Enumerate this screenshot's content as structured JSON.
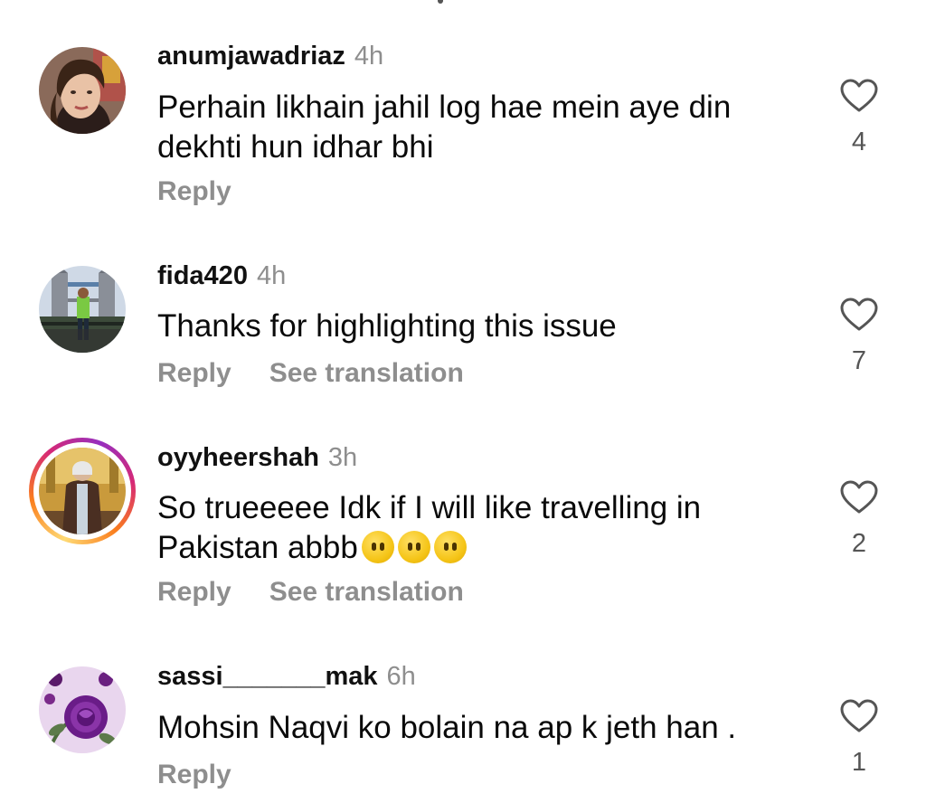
{
  "comments": [
    {
      "username": "anumjawadriaz",
      "time": "4h",
      "text": "Perhain likhain jahil log hae mein aye din dekhti hun idhar bhi",
      "reply_label": "Reply",
      "like_count": "4",
      "avatar": "woman-selfie-avatar"
    },
    {
      "username": "fida420",
      "time": "4h",
      "text": "Thanks for highlighting this issue",
      "reply_label": "Reply",
      "translate_label": "See translation",
      "like_count": "7",
      "avatar": "tower-bridge-photo-avatar"
    },
    {
      "username": "oyyheershah",
      "time": "3h",
      "text": "So trueeeee Idk if I will like travelling in Pakistan abbb",
      "emoji": [
        "neutral-face-emoji",
        "neutral-face-emoji",
        "neutral-face-emoji"
      ],
      "reply_label": "Reply",
      "translate_label": "See translation",
      "like_count": "2",
      "avatar": "person-in-coat-avatar",
      "has_story_ring": true
    },
    {
      "username": "sassi_______mak",
      "time": "6h",
      "text": "Mohsin Naqvi ko bolain na ap k jeth han .",
      "reply_label": "Reply",
      "like_count": "1",
      "avatar": "purple-rose-avatar"
    }
  ],
  "colors": {
    "secondary_text": "#8e8e8e",
    "primary_text": "#000000",
    "like_icon_stroke": "#555555",
    "story_ring": [
      "#feda75",
      "#fa7e1e",
      "#d62976",
      "#962fbf"
    ]
  }
}
